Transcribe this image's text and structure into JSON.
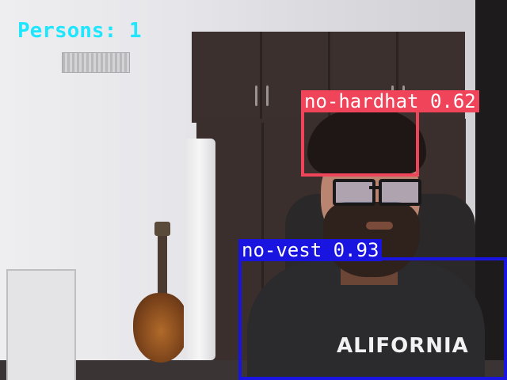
{
  "overlay": {
    "count_text": "Persons: 1"
  },
  "detections": [
    {
      "label": "no-hardhat 0.62",
      "class": "no-hardhat",
      "confidence": 0.62,
      "color": "#f0445a"
    },
    {
      "label": "no-vest 0.93",
      "class": "no-vest",
      "confidence": 0.93,
      "color": "#1a14e0"
    }
  ],
  "shirt": {
    "print": "ALIFORNIA"
  },
  "colors": {
    "count_text": "#1ee6ff",
    "no_hardhat_box": "#f0445a",
    "no_vest_box": "#1a14e0",
    "label_text": "#ffffff"
  },
  "icons": [
    "camera-frame"
  ]
}
